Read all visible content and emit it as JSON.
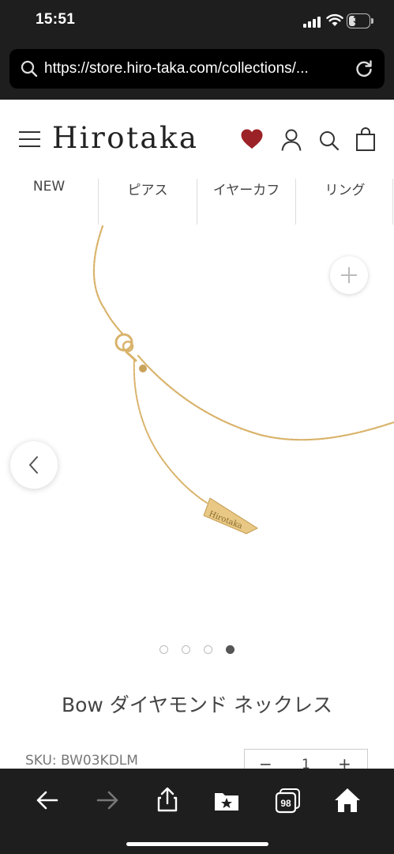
{
  "status_bar": {
    "time": "15:51",
    "battery": "35"
  },
  "browser": {
    "url": "https://store.hiro-taka.com/collections/..."
  },
  "header": {
    "logo": "Hirotaka",
    "icons": [
      "menu-icon",
      "heart-icon",
      "account-icon",
      "search-icon",
      "bag-icon"
    ],
    "heart_color": "#9b2226"
  },
  "categories": [
    {
      "label": "NEW"
    },
    {
      "label": "ピアス"
    },
    {
      "label": "イヤーカフ"
    },
    {
      "label": "リング"
    }
  ],
  "gallery": {
    "image_count": 4,
    "current_image": 4,
    "engraving": "Hirotaka"
  },
  "product": {
    "title": "Bow ダイヤモンド ネックレス",
    "sku": "SKU: BW03KDLM",
    "quantity": {
      "minus": "−",
      "value": "1",
      "plus": "+"
    }
  },
  "toolbar": {
    "tabs_count": "98",
    "icons": [
      "back-icon",
      "forward-icon",
      "share-icon",
      "bookmarks-icon",
      "tabs-icon",
      "home-icon"
    ]
  }
}
